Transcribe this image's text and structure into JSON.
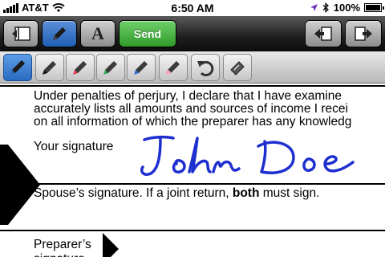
{
  "status_bar": {
    "carrier": "AT&T",
    "time": "6:50 AM",
    "battery": "100%",
    "battery_level": 1.0
  },
  "top_toolbar": {
    "send_label": "Send",
    "text_tool_label": "A"
  },
  "pen_toolbar": {
    "tools": [
      {
        "name": "pen-blue",
        "color": "#2a6cc2"
      },
      {
        "name": "marker-black",
        "color": "#222222"
      },
      {
        "name": "marker-red",
        "color": "#e04050"
      },
      {
        "name": "marker-green",
        "color": "#2fa85a"
      },
      {
        "name": "marker-blue",
        "color": "#2f6fe0"
      },
      {
        "name": "eraser",
        "color": "#f3a6b8"
      }
    ]
  },
  "document": {
    "declaration_lines": [
      "Under penalties of perjury, I declare that I have examine",
      "accurately lists all amounts and sources of income I recei",
      "on all information of which the preparer has any knowledg"
    ],
    "your_signature_label": "Your signature",
    "signature_text": "John Doe",
    "signature_color": "#1e2fd0",
    "spouse_label_part1": "Spouse’s signature. If a joint return, ",
    "spouse_label_bold": "both",
    "spouse_label_part2": " must sign.",
    "preparer_label_line1": "Preparer’s",
    "preparer_label_line2": "signature"
  }
}
